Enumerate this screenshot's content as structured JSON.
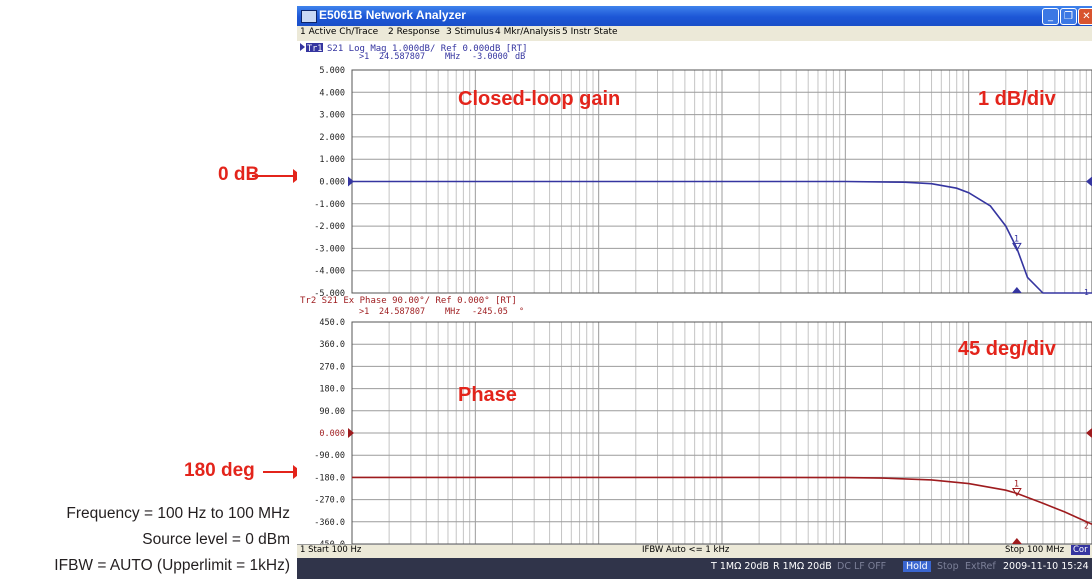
{
  "window": {
    "title": "E5061B Network Analyzer",
    "controls": [
      "minimize-icon",
      "restore-icon",
      "close-icon"
    ]
  },
  "menu": [
    "1 Active Ch/Trace",
    "2 Response",
    "3 Stimulus",
    "4 Mkr/Analysis",
    "5 Instr State"
  ],
  "trace1": {
    "label": "Tr1",
    "header": "S21 Log Mag 1.000dB/ Ref 0.000dB [RT]",
    "color": "#3535a0",
    "y_ticks": [
      "5.000",
      "4.000",
      "3.000",
      "2.000",
      "1.000",
      "0.000",
      "-1.000",
      "-2.000",
      "-3.000",
      "-4.000",
      "-5.000"
    ],
    "marker_readout": {
      "number": ">1",
      "frequency": "24.587807",
      "unit": "MHz",
      "value": "-3.0000",
      "value_unit": "dB"
    },
    "marker_label": "1",
    "right_edge_label": "1"
  },
  "trace2": {
    "header": "Tr2 S21 Ex Phase 90.00°/ Ref 0.000° [RT]",
    "color": "#9e1b1e",
    "y_ticks": [
      "450.0",
      "360.0",
      "270.0",
      "180.0",
      "90.00",
      "0.000",
      "-90.00",
      "-180.0",
      "-270.0",
      "-360.0",
      "-450.0"
    ],
    "marker_readout": {
      "number": ">1",
      "frequency": "24.587807",
      "unit": "MHz",
      "value": "-245.05",
      "value_unit": "°"
    },
    "marker_label": "1",
    "right_edge_label": "2"
  },
  "annotations": {
    "gain_title": "Closed-loop gain",
    "gain_scale": "1 dB/div",
    "phase_title": "Phase",
    "phase_scale": "45 deg/div",
    "zero_db": "0 dB",
    "phase_ref": "180 deg"
  },
  "measurement_notes": [
    "Frequency = 100 Hz to 100 MHz",
    "Source level = 0 dBm",
    "IFBW = AUTO (Upperlimit = 1kHz)"
  ],
  "status_bar": {
    "start": "1  Start 100 Hz",
    "ifbw": "IFBW Auto <= 1 kHz",
    "stop": "Stop 100 MHz",
    "cor": "Cor",
    "t_input": "T 1MΩ 20dB",
    "r_input": "R 1MΩ 20dB",
    "dc_lf": "DC LF OFF",
    "hold": "Hold",
    "stop_state": "Stop",
    "ext_ref": "ExtRef",
    "datetime": "2009-11-10 15:24"
  },
  "chart_data": [
    {
      "type": "line",
      "title": "S21 Log Mag 1.000dB/ Ref 0.000dB [RT]",
      "x_scale": "log",
      "xlim": [
        100,
        100000000
      ],
      "ylim": [
        -5,
        5
      ],
      "grid": true,
      "series": [
        {
          "name": "Tr1",
          "x": [
            100,
            1000,
            10000,
            100000,
            1000000,
            3000000,
            5000000,
            8000000,
            10000000,
            15000000,
            20000000,
            24587807,
            30000000,
            40000000,
            50000000,
            100000000
          ],
          "y": [
            0,
            0,
            0,
            0,
            0,
            -0.03,
            -0.1,
            -0.3,
            -0.5,
            -1.1,
            -2.0,
            -3.0,
            -4.3,
            -5.0,
            -5.0,
            -5.0
          ]
        }
      ],
      "marker": {
        "x": 24587807,
        "y": -3.0
      }
    },
    {
      "type": "line",
      "title": "S21 Ex Phase 90.00°/ Ref 0.000° [RT]",
      "x_scale": "log",
      "xlim": [
        100,
        100000000
      ],
      "ylim": [
        -450,
        450
      ],
      "grid": true,
      "series": [
        {
          "name": "Tr2",
          "x": [
            100,
            1000,
            10000,
            100000,
            1000000,
            2000000,
            5000000,
            10000000,
            20000000,
            24587807,
            40000000,
            60000000,
            100000000
          ],
          "y": [
            -180,
            -180,
            -180,
            -180,
            -181,
            -183,
            -190,
            -205,
            -232,
            -245.05,
            -285,
            -320,
            -370
          ]
        }
      ],
      "marker": {
        "x": 24587807,
        "y": -245.05
      }
    }
  ]
}
